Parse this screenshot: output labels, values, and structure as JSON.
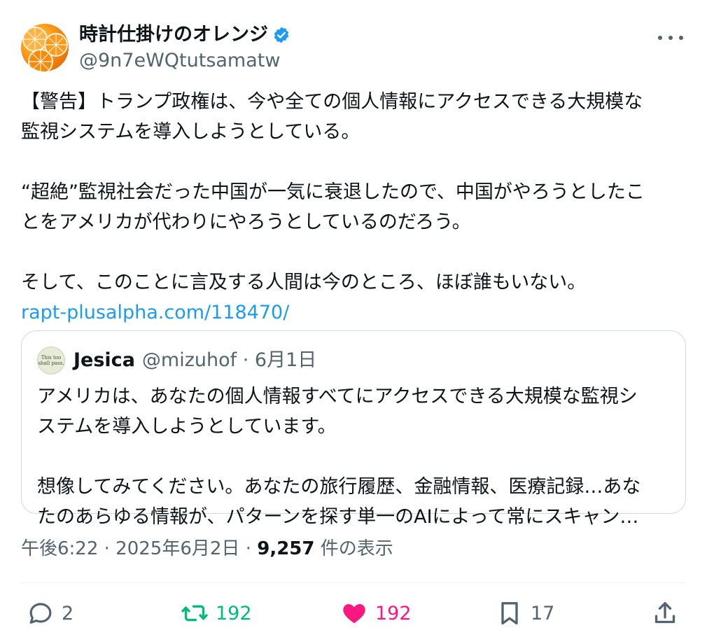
{
  "author": {
    "display_name": "時計仕掛けのオレンジ",
    "handle": "@9n7eWQtutsamatw",
    "verified": true,
    "avatar_icon": "orange-slices-avatar"
  },
  "post": {
    "paragraphs": [
      [
        "【警告】トランプ政権は、今や全ての個人情報にアクセスできる大規模な",
        "監視システムを導入しようとしている。"
      ],
      [
        "“超絶”監視社会だった中国が一気に衰退したので、中国がやろうとしたこ",
        "とをアメリカが代わりにやろうとしているのだろう。"
      ],
      [
        "そして、このことに言及する人間は今のところ、ほぼ誰もいない。"
      ]
    ],
    "link": "rapt-plusalpha.com/118470/"
  },
  "quoted": {
    "avatar_text": "This too shall pass.",
    "name": "Jesica",
    "handle_date": "@mizuhof · 6月1日",
    "paragraphs": [
      [
        "アメリカは、あなたの個人情報すべてにアクセスできる大規模な監視シ",
        "ステムを導入しようとしています。"
      ],
      [
        "想像してみてください。あなたの旅行履歴、金融情報、医療記録…あな",
        "たのあらゆる情報が、パターンを探す単一のAIによって常にスキャン…"
      ]
    ]
  },
  "meta": {
    "time_date": "午後6:22 · 2025年6月2日 · ",
    "views": "9,257",
    "views_label": " 件の表示"
  },
  "actions": {
    "replies": "2",
    "reposts": "192",
    "likes": "192",
    "bookmarks": "17"
  },
  "colors": {
    "link": "#1d9bf0",
    "verified": "#1d9bf0",
    "repost": "#00ba7c",
    "like": "#f91880",
    "secondary_text": "#536471",
    "border": "#cfd9de"
  }
}
